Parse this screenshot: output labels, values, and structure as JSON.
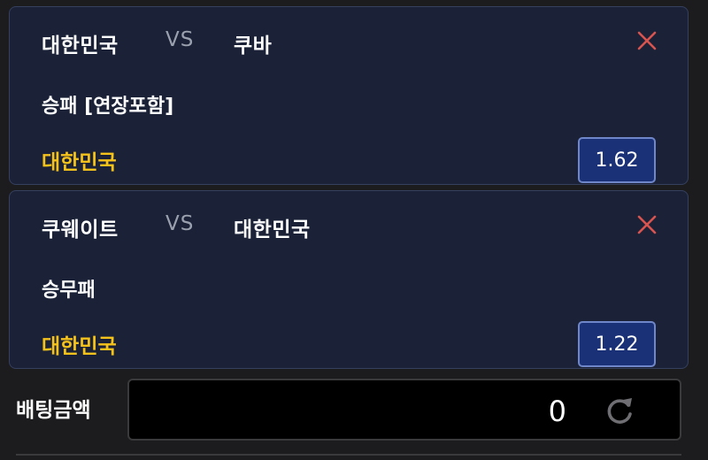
{
  "bets": [
    {
      "home_team": "대한민국",
      "vs": "VS",
      "away_team": "쿠바",
      "market": "승패 [연장포함]",
      "selection": "대한민국",
      "odds": "1.62"
    },
    {
      "home_team": "쿠웨이트",
      "vs": "VS",
      "away_team": "대한민국",
      "market": "승무패",
      "selection": "대한민국",
      "odds": "1.22"
    }
  ],
  "bet_amount": {
    "label": "배팅금액",
    "value": "0"
  },
  "icons": {
    "remove": "close-icon",
    "reset": "refresh-icon"
  },
  "colors": {
    "card_bg": "#1b2238",
    "card_border": "#34405e",
    "selection_text": "#f4c21a",
    "odds_bg": "#1a3178",
    "odds_border": "#6f86c8",
    "remove_icon": "#d9534f",
    "vs_text": "#9aa0ad"
  }
}
